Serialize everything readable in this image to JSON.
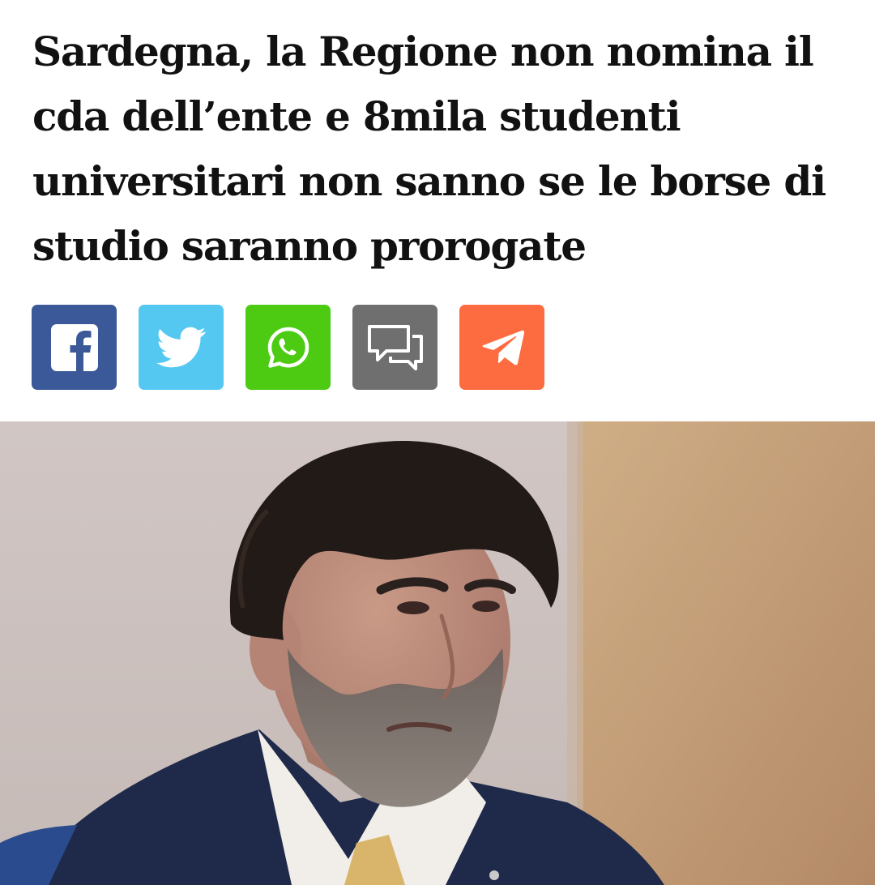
{
  "article": {
    "headline": "Sardegna, la Regione non nomina il cda dell’ente e 8mila studenti universitari non sanno se le borse di studio saranno prorogate"
  },
  "share_buttons": [
    {
      "service": "Facebook",
      "icon": "facebook-icon",
      "color": "#3b5998"
    },
    {
      "service": "Twitter",
      "icon": "twitter-icon",
      "color": "#55c8f2"
    },
    {
      "service": "WhatsApp",
      "icon": "whatsapp-icon",
      "color": "#4ccb12"
    },
    {
      "service": "Comments",
      "icon": "comments-icon",
      "color": "#6f6f6f"
    },
    {
      "service": "Telegram",
      "icon": "telegram-icon",
      "color": "#fd6c40"
    }
  ],
  "hero_image": {
    "subject": "portrait-photo"
  }
}
